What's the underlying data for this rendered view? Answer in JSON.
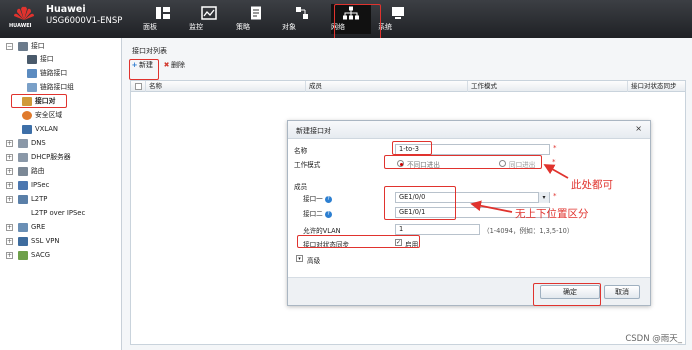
{
  "header": {
    "brand": "HUAWEI",
    "title": "Huawei",
    "model": "USG6000V1-ENSP",
    "nav": [
      {
        "label": "面板",
        "icon": "dashboard-icon"
      },
      {
        "label": "监控",
        "icon": "monitor-icon"
      },
      {
        "label": "策略",
        "icon": "policy-icon"
      },
      {
        "label": "对象",
        "icon": "object-icon"
      },
      {
        "label": "网络",
        "icon": "network-icon"
      },
      {
        "label": "系统",
        "icon": "system-icon"
      }
    ]
  },
  "sidebar": {
    "items": [
      {
        "label": "接口"
      },
      {
        "label": "接口"
      },
      {
        "label": "链路接口"
      },
      {
        "label": "链路接口组"
      },
      {
        "label": "接口对"
      },
      {
        "label": "安全区域"
      },
      {
        "label": "VXLAN"
      },
      {
        "label": "DNS"
      },
      {
        "label": "DHCP服务器"
      },
      {
        "label": "路由"
      },
      {
        "label": "IPSec"
      },
      {
        "label": "L2TP"
      },
      {
        "label": "L2TP over IPSec"
      },
      {
        "label": "GRE"
      },
      {
        "label": "SSL VPN"
      },
      {
        "label": "SACG"
      }
    ]
  },
  "main": {
    "title": "接口对列表",
    "toolbar": {
      "add": "新建",
      "delete": "删除"
    },
    "columns": [
      "名称",
      "成员",
      "工作模式",
      "接口对状态同步"
    ]
  },
  "dialog": {
    "title": "新建接口对",
    "close": "×",
    "name_label": "名称",
    "name_value": "1-to-3",
    "mode_label": "工作模式",
    "mode_opt1": "不同口进出",
    "mode_opt2": "同口进出",
    "members_label": "成员",
    "if1_label": "接口一",
    "if1_value": "GE1/0/0",
    "if2_label": "接口二",
    "if2_value": "GE1/0/1",
    "vlan_label": "允许的VLAN",
    "vlan_value": "1",
    "vlan_hint": "（1-4094，例如：1,3,5-10）",
    "sync_label": "接口对状态同步",
    "sync_option": "启用",
    "advanced": "高级",
    "ok": "确定",
    "cancel": "取消"
  },
  "annotations": {
    "note1": "此处都可",
    "note2": "无上下位置区分"
  },
  "watermark": "CSDN @雨天_"
}
